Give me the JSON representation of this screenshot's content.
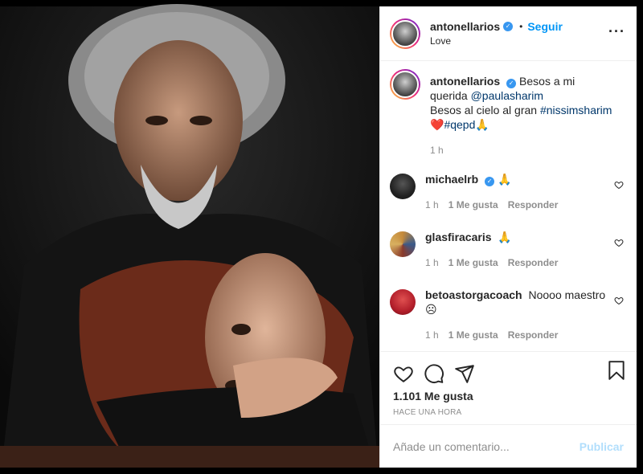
{
  "post": {
    "username": "antonellarios",
    "follow_label": "Seguir",
    "location": "Love",
    "more_icon": "more-horizontal-icon",
    "caption": {
      "username": "antonellarios",
      "text_before": "Besos a mi querida",
      "mention": "@paulasharim",
      "text_middle": "Besos al cielo al gran",
      "hashtag1": "#nissimsharim",
      "emoji_heart": "❤️",
      "hashtag2": "#qepd",
      "emoji_pray": "🙏",
      "time": "1 h"
    },
    "comments": [
      {
        "username": "michaelrb",
        "verified": true,
        "text": "🙏",
        "time": "1 h",
        "likes": "1 Me gusta",
        "reply": "Responder"
      },
      {
        "username": "glasfiracaris",
        "verified": false,
        "text": "🙏",
        "time": "1 h",
        "likes": "1 Me gusta",
        "reply": "Responder"
      },
      {
        "username": "betoastorgacoach",
        "verified": false,
        "text": "Noooo maestro ☹",
        "time": "1 h",
        "likes": "1 Me gusta",
        "reply": "Responder"
      }
    ],
    "likes_count": "1.101 Me gusta",
    "posted_time": "HACE UNA HORA",
    "add_comment_placeholder": "Añade un comentario...",
    "publish_label": "Publicar",
    "colors": {
      "link": "#00376b",
      "accent": "#0095f6",
      "verified": "#3897f0",
      "muted": "#8e8e8e"
    }
  }
}
